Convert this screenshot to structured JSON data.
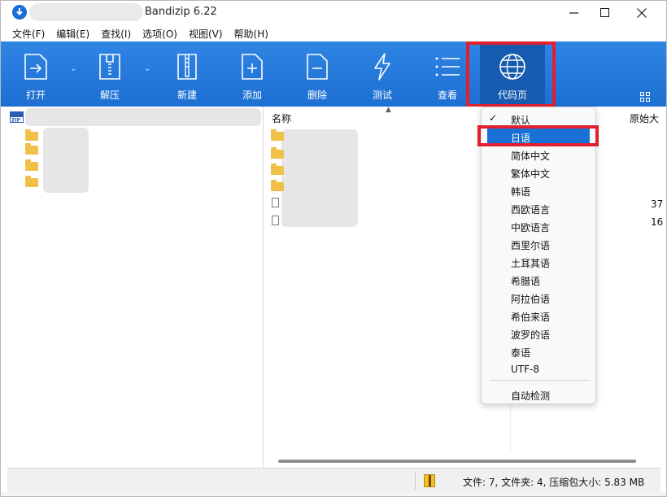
{
  "window": {
    "title": "Bandizip 6.22"
  },
  "menubar": {
    "items": [
      "文件(F)",
      "编辑(E)",
      "查找(I)",
      "选项(O)",
      "视图(V)",
      "帮助(H)"
    ]
  },
  "toolbar": {
    "buttons": [
      {
        "label": "打开",
        "icon": "open-icon"
      },
      {
        "label": "解压",
        "icon": "extract-icon"
      },
      {
        "label": "新建",
        "icon": "new-archive-icon"
      },
      {
        "label": "添加",
        "icon": "add-file-icon"
      },
      {
        "label": "删除",
        "icon": "delete-file-icon"
      },
      {
        "label": "测试",
        "icon": "test-icon"
      },
      {
        "label": "查看",
        "icon": "view-icon"
      },
      {
        "label": "代码页",
        "icon": "globe-icon"
      }
    ]
  },
  "file_list": {
    "columns": {
      "name": "名称",
      "original_size": "原始大"
    },
    "visible_values": [
      "37",
      "16"
    ]
  },
  "codepage_menu": {
    "items": [
      {
        "label": "默认",
        "checked": true
      },
      {
        "label": "日语",
        "selected": true
      },
      {
        "label": "简体中文"
      },
      {
        "label": "繁体中文"
      },
      {
        "label": "韩语"
      },
      {
        "label": "西欧语言"
      },
      {
        "label": "中欧语言"
      },
      {
        "label": "西里尔语"
      },
      {
        "label": "土耳其语"
      },
      {
        "label": "希腊语"
      },
      {
        "label": "阿拉伯语"
      },
      {
        "label": "希伯来语"
      },
      {
        "label": "波罗的语"
      },
      {
        "label": "泰语"
      },
      {
        "label": "UTF-8"
      }
    ],
    "auto_detect": "自动检测"
  },
  "statusbar": {
    "text": "文件: 7, 文件夹: 4, 压缩包大小: 5.83 MB"
  },
  "colors": {
    "toolbar": "#1d6fd2",
    "selection": "#1971d6",
    "highlight_box": "#e0202e"
  }
}
